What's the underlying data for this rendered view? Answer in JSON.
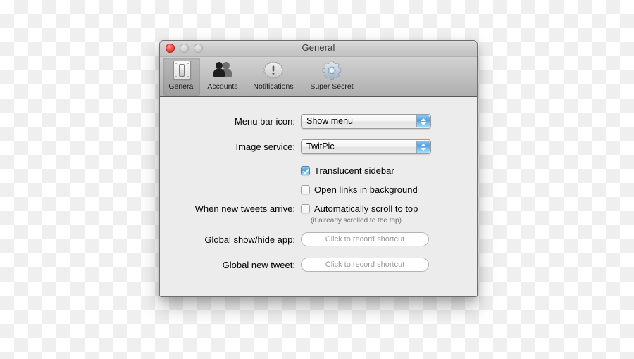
{
  "window": {
    "title": "General",
    "traffic_lights": [
      {
        "name": "close",
        "active": true
      },
      {
        "name": "minimize",
        "active": false
      },
      {
        "name": "zoom",
        "active": false
      }
    ]
  },
  "toolbar": {
    "tabs": [
      {
        "label": "General",
        "icon": "switch-plate-icon",
        "selected": true
      },
      {
        "label": "Accounts",
        "icon": "people-icon",
        "selected": false
      },
      {
        "label": "Notifications",
        "icon": "burst-alert-icon",
        "selected": false
      },
      {
        "label": "Super Secret",
        "icon": "gear-icon",
        "selected": false
      }
    ]
  },
  "content": {
    "menu_bar_icon": {
      "label": "Menu bar icon:",
      "value": "Show menu"
    },
    "image_service": {
      "label": "Image service:",
      "value": "TwitPic"
    },
    "translucent_sidebar": {
      "label": "Translucent sidebar",
      "checked": true
    },
    "open_links_background": {
      "label": "Open links in background",
      "checked": false
    },
    "new_tweets_arrive": {
      "label": "When new tweets arrive:",
      "checkbox_label": "Automatically scroll to top",
      "note": "(if already scrolled to the top)",
      "checked": false
    },
    "global_show_hide": {
      "label": "Global show/hide app:",
      "placeholder": "Click to record shortcut"
    },
    "global_new_tweet": {
      "label": "Global new tweet:",
      "placeholder": "Click to record shortcut"
    }
  },
  "colors": {
    "accent_blue": "#4a9bdf",
    "close_red": "#f4534a",
    "content_bg": "#ececec",
    "toolbar_top": "#d2d2d2",
    "toolbar_bottom": "#adadad"
  }
}
